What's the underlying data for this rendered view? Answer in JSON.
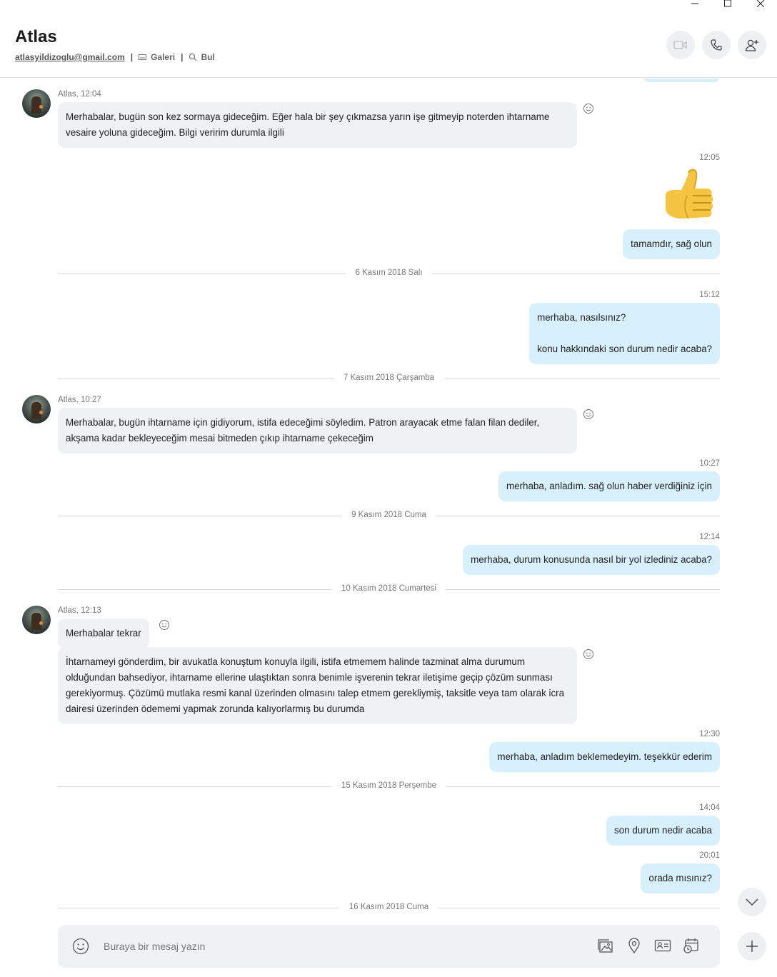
{
  "header": {
    "title": "Atlas",
    "email": "atlasyildizoglu@gmail.com",
    "gallery_label": "Galeri",
    "find_label": "Bul",
    "separator": "|"
  },
  "messages": {
    "m1": {
      "meta": "Atlas, 12:04",
      "text": "Merhabalar, bugün son kez sormaya gideceğim. Eğer hala bir şey çıkmazsa yarın işe gitmeyip noterden ihtarname vesaire yoluna gideceğim. Bilgi veririm durumla ilgili"
    },
    "m2": {
      "time": "12:05",
      "sticker": "thumbs-up",
      "text": "tamamdır, sağ olun"
    },
    "d1": "6 Kasım 2018 Salı",
    "m3": {
      "time": "15:12",
      "text": "merhaba, nasılsınız?\n\nkonu hakkındaki son durum nedir acaba?"
    },
    "d2": "7 Kasım 2018 Çarşamba",
    "m4": {
      "meta": "Atlas, 10:27",
      "text": "Merhabalar, bugün ihtarname için gidiyorum, istifa edeceğimi söyledim. Patron arayacak etme falan filan dediler, akşama kadar bekleyeceğim mesai bitmeden çıkıp ihtarname çekeceğim"
    },
    "m5": {
      "time": "10:27",
      "text": "merhaba, anladım. sağ olun haber verdiğiniz için"
    },
    "d3": "9 Kasım 2018 Cuma",
    "m6": {
      "time": "12:14",
      "text": "merhaba, durum konusunda nasıl bir yol izlediniz acaba?"
    },
    "d4": "10 Kasım 2018 Cumartesi",
    "m7": {
      "meta": "Atlas, 12:13",
      "text": "Merhabalar tekrar"
    },
    "m8": {
      "text": "İhtarnameyi gönderdim, bir avukatla konuştum konuyla ilgili, istifa etmemem halinde tazminat alma durumum olduğundan bahsediyor, ihtarname ellerine ulaştıktan sonra benimle işverenin tekrar iletişime geçip çözüm sunması gerekiyormuş. Çözümü mutlaka resmi kanal üzerinden olmasını talep etmem gerekliymiş, taksitle veya tam olarak icra dairesi üzerinden ödememi yapmak zorunda kalıyorlarmış bu durumda"
    },
    "m9": {
      "time": "12:30",
      "text": "merhaba, anladım beklemedeyim. teşekkür ederim"
    },
    "d5": "15 Kasım 2018 Perşembe",
    "m10": {
      "time": "14:04",
      "text": "son durum nedir acaba"
    },
    "m11": {
      "time": "20:01",
      "text": "orada mısınız?"
    },
    "d6": "16 Kasım 2018 Cuma"
  },
  "composer": {
    "placeholder": "Buraya bir mesaj yazın"
  },
  "icons": {
    "window": [
      "minimize-icon",
      "maximize-icon",
      "close-icon"
    ],
    "header": [
      "video-call-icon",
      "audio-call-icon",
      "add-people-icon",
      "gallery-icon",
      "search-icon"
    ],
    "composer": [
      "emoji-icon",
      "media-gallery-icon",
      "location-icon",
      "contact-card-icon",
      "schedule-icon",
      "plus-icon"
    ]
  },
  "colors": {
    "outgoing_bubble": "#d8f0fb",
    "incoming_bubble": "#eef2f5",
    "divider": "#d6d6d6",
    "round_button": "#eef0f2"
  }
}
